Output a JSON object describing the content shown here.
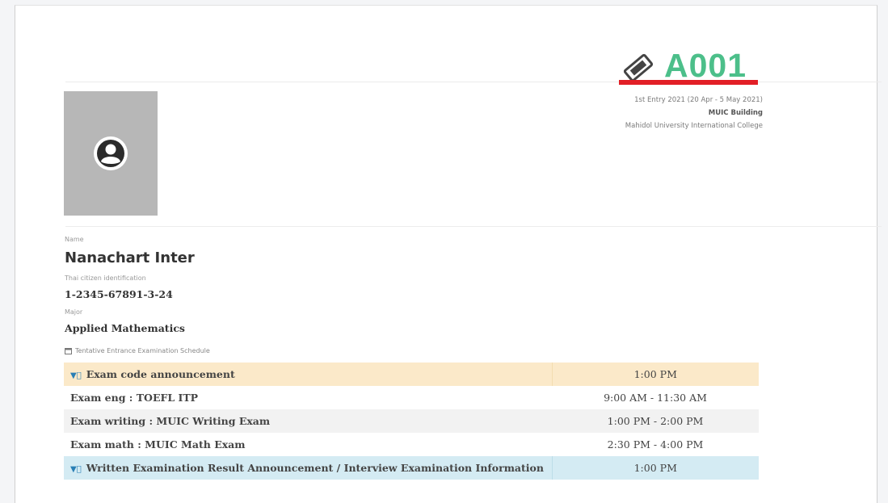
{
  "ticket": {
    "code": "A001",
    "code_color": "#4cbf8a",
    "underline_color": "#e21f26",
    "icon": "ticket-icon"
  },
  "entry": {
    "round": "1st Entry 2021 (20 Apr - 5 May 2021)",
    "building": "MUIC Building",
    "institution": "Mahidol University International College"
  },
  "profile": {
    "avatar_icon": "user-avatar-icon",
    "name_label": "Name",
    "name": "Nanachart Inter",
    "citizen_label": "Thai citizen identification",
    "citizen_id": "1-2345-67891-3-24",
    "major_label": "Major",
    "major": "Applied Mathematics"
  },
  "schedule": {
    "title_icon": "calendar-icon",
    "title": "Tentative Entrance Examination Schedule",
    "rows": [
      {
        "icon": "flag-icon",
        "name": "Exam code announcement",
        "time": "1:00 PM"
      },
      {
        "name": "Exam eng : TOEFL ITP",
        "time": "9:00 AM - 11:30 AM"
      },
      {
        "name": "Exam writing : MUIC Writing Exam",
        "time": "1:00 PM - 2:00 PM"
      },
      {
        "name": "Exam math : MUIC Math Exam",
        "time": "2:30 PM - 4:00 PM"
      },
      {
        "icon": "flag-icon",
        "name": "Written Examination Result Announcement / Interview Examination Information",
        "time": "1:00 PM"
      }
    ]
  }
}
